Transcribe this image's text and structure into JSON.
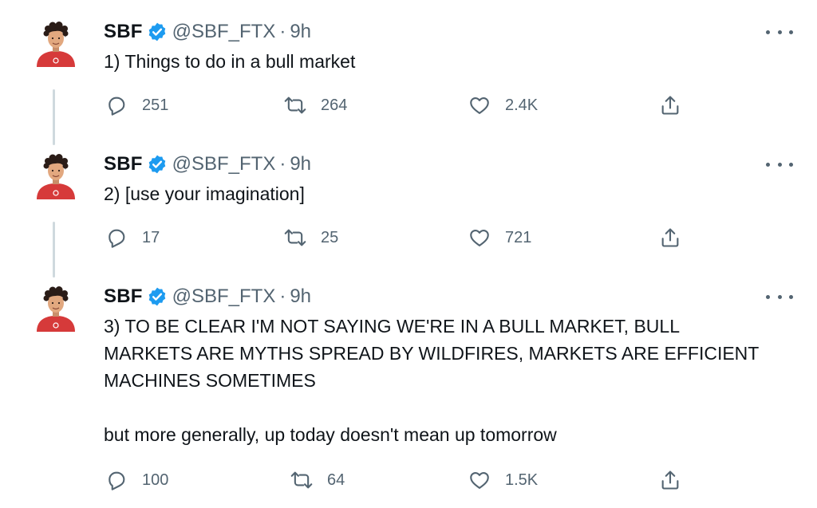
{
  "colors": {
    "verified": "#1d9bf0",
    "text": "#0f1419",
    "muted": "#536471",
    "thread_line": "#cfd9de",
    "avatar_shirt": "#d63a3a"
  },
  "tweets": [
    {
      "name": "SBF",
      "handle": "@SBF_FTX",
      "separator": "·",
      "time": "9h",
      "text": "1) Things to do in a bull market",
      "replies": "251",
      "retweets": "264",
      "likes": "2.4K"
    },
    {
      "name": "SBF",
      "handle": "@SBF_FTX",
      "separator": "·",
      "time": "9h",
      "text": "2) [use your imagination]",
      "replies": "17",
      "retweets": "25",
      "likes": "721"
    },
    {
      "name": "SBF",
      "handle": "@SBF_FTX",
      "separator": "·",
      "time": "9h",
      "text": "3) TO BE CLEAR I'M NOT SAYING WE'RE IN A BULL MARKET, BULL\nMARKETS ARE MYTHS SPREAD BY WILDFIRES, MARKETS ARE EFFICIENT\nMACHINES SOMETIMES\n\nbut more generally, up today doesn't mean up tomorrow",
      "replies": "100",
      "retweets": "64",
      "likes": "1.5K"
    }
  ],
  "icons": {
    "verified": "verified-badge-icon",
    "more": "more-options-icon",
    "reply": "reply-icon",
    "retweet": "retweet-icon",
    "like": "like-icon",
    "share": "share-icon"
  }
}
